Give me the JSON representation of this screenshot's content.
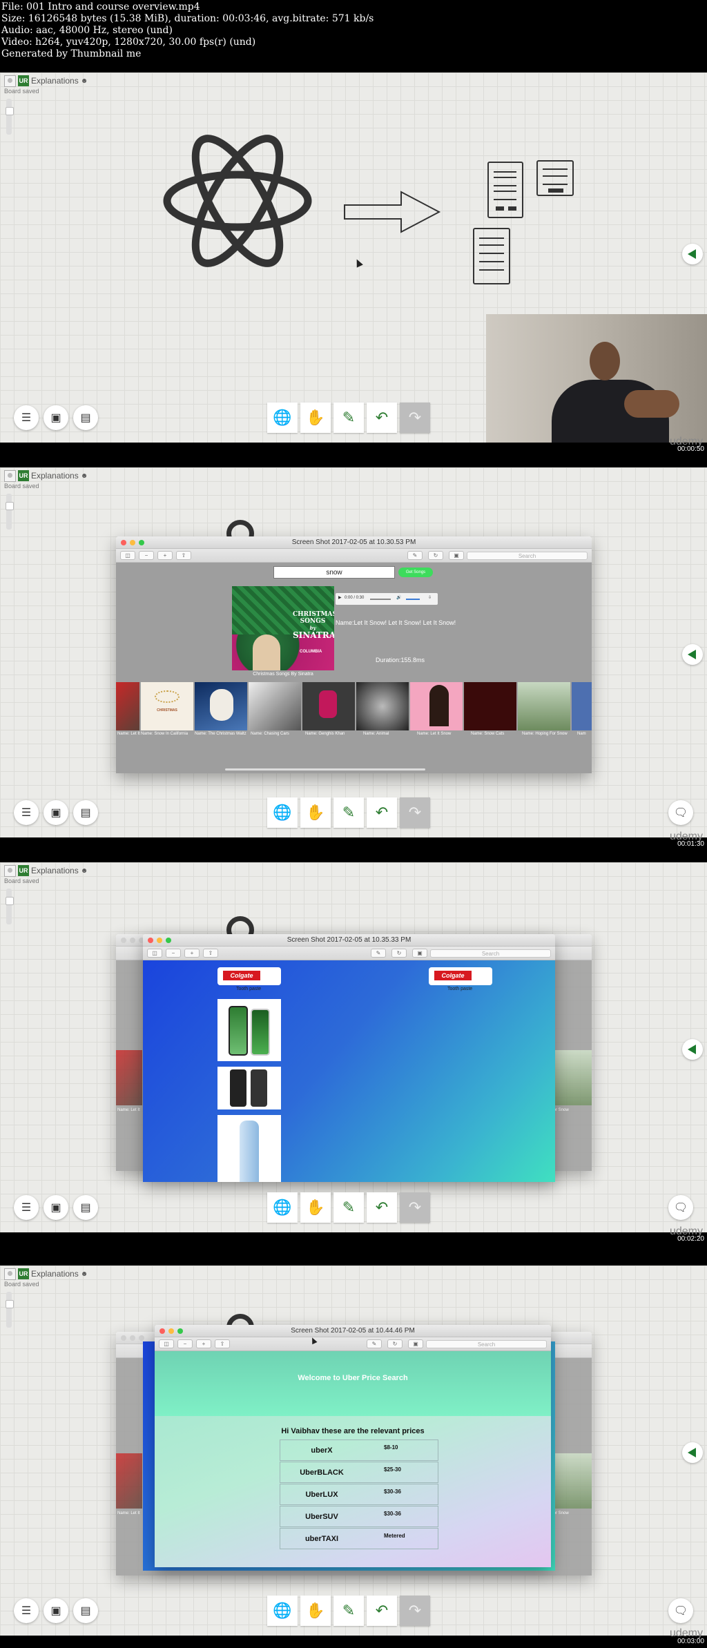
{
  "file_info": [
    "File: 001 Intro and course overview.mp4",
    "Size: 16126548 bytes (15.38 MiB), duration: 00:03:46, avg.bitrate: 571 kb/s",
    "Audio: aac, 48000 Hz, stereo (und)",
    "Video: h264, yuv420p, 1280x720, 30.00 fps(r) (und)",
    "Generated by Thumbnail me"
  ],
  "board": {
    "badge": "UR",
    "title": "Explanations",
    "user_icon": "☻",
    "saved_text": "Board saved"
  },
  "watermark": "udemy",
  "timestamps": [
    "00:00:50",
    "00:01:30",
    "00:02:20",
    "00:03:00"
  ],
  "icons": {
    "left_tools": [
      "layers-icon",
      "image-icon",
      "document-icon"
    ],
    "center_tools": [
      "globe-icon",
      "hand-icon",
      "pencil-icon",
      "undo-icon",
      "redo-icon"
    ],
    "side": "collapse-arrow-icon",
    "chat": "chat-icon"
  },
  "accent_color": "#2e7d32",
  "frame2": {
    "window_title": "Screen Shot 2017-02-05 at 10.30.53 PM",
    "search_placeholder": "Search",
    "search_value": "snow",
    "get_songs_label": "Get Songs",
    "time_display": "0:00 / 0:30",
    "song_name": "Name:Let It Snow! Let It Snow! Let It Snow!",
    "duration": "Duration:155.8ms",
    "album_title_lines": [
      "CHRISTMAS SONGS",
      "by",
      "SINATRA"
    ],
    "album_label": "COLUMBIA",
    "album_caption": "Christmas Songs By Sinatra",
    "carousel_captions": [
      "Name: Let It",
      "Name: Snow In California",
      "Name: The Christmas Waltz",
      "Name: Chasing Cars",
      "Name: Genghis Khan",
      "Name: Animal",
      "Name: Let It Snow",
      "Name: Snow Cats",
      "Name: Hoping For Snow",
      "Nam"
    ]
  },
  "frame3": {
    "window_title": "Screen Shot 2017-02-05 at 10.35.33 PM",
    "search_placeholder": "Search",
    "brand": "Colgate",
    "tooth_paste_label": "Tooth paste",
    "side_captions": [
      "Name: Let It",
      "For Snow"
    ]
  },
  "frame4": {
    "window_title": "Screen Shot 2017-02-05 at 10.44.46 PM",
    "search_placeholder": "Search",
    "welcome": "Welcome to Uber Price Search",
    "greeting": "Hi Vaibhav these are the relevant prices",
    "prices": [
      {
        "name": "uberX",
        "price": "$8-10"
      },
      {
        "name": "UberBLACK",
        "price": "$25-30"
      },
      {
        "name": "UberLUX",
        "price": "$30-36"
      },
      {
        "name": "UberSUV",
        "price": "$30-36"
      },
      {
        "name": "uberTAXI",
        "price": "Metered"
      }
    ],
    "side_captions": [
      "Name: Let It",
      "For Snow"
    ]
  }
}
